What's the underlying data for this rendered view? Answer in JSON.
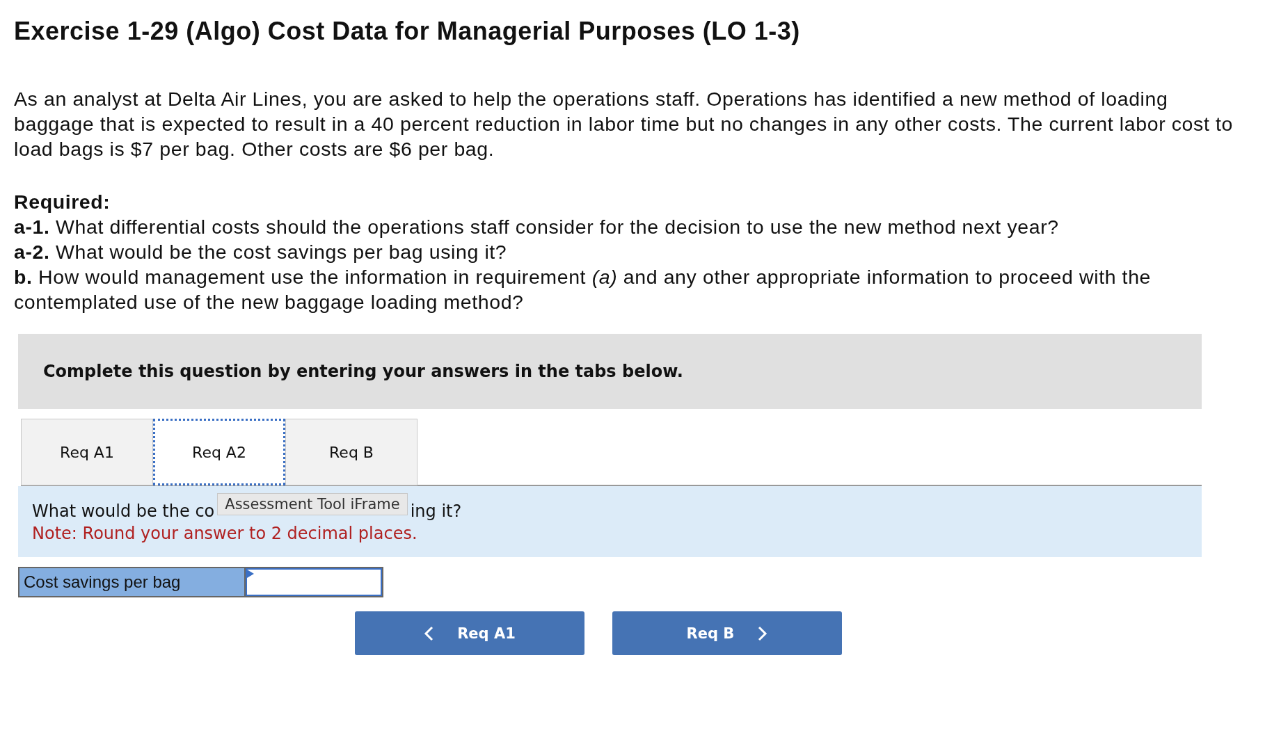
{
  "title": "Exercise 1-29 (Algo) Cost Data for Managerial Purposes (LO 1-3)",
  "intro": "As an analyst at Delta Air Lines, you are asked to help the operations staff. Operations has identified a new method of loading baggage that is expected to result in a 40 percent reduction in labor time but no changes in any other costs. The current labor cost to load bags is $7 per bag. Other costs are $6 per bag.",
  "required_heading": "Required:",
  "requirements": [
    "**a-1.** What differential costs should the operations staff consider for the decision to use the new method next year?",
    "**a-2.** What would be the cost savings per bag using it?",
    "**b.** How would management use the information in requirement *(a)* and any other appropriate information to proceed with the contemplated use of the new baggage loading method?"
  ],
  "instruction": "Complete this question by entering your answers in the tabs below.",
  "tabs": [
    {
      "label": "Req A1",
      "selected": false
    },
    {
      "label": "Req A2",
      "selected": true
    },
    {
      "label": "Req B",
      "selected": false
    }
  ],
  "question_before_tooltip": "What would be the co",
  "tooltip": "Assessment Tool iFrame",
  "question_after_tooltip": "ing it?",
  "note": "Note: Round your answer to 2 decimal places.",
  "answer_row": {
    "label": "Cost savings per bag"
  },
  "nav_buttons": [
    {
      "label": "Req A1",
      "kind": "prev"
    },
    {
      "label": "Req B",
      "kind": "next"
    }
  ]
}
